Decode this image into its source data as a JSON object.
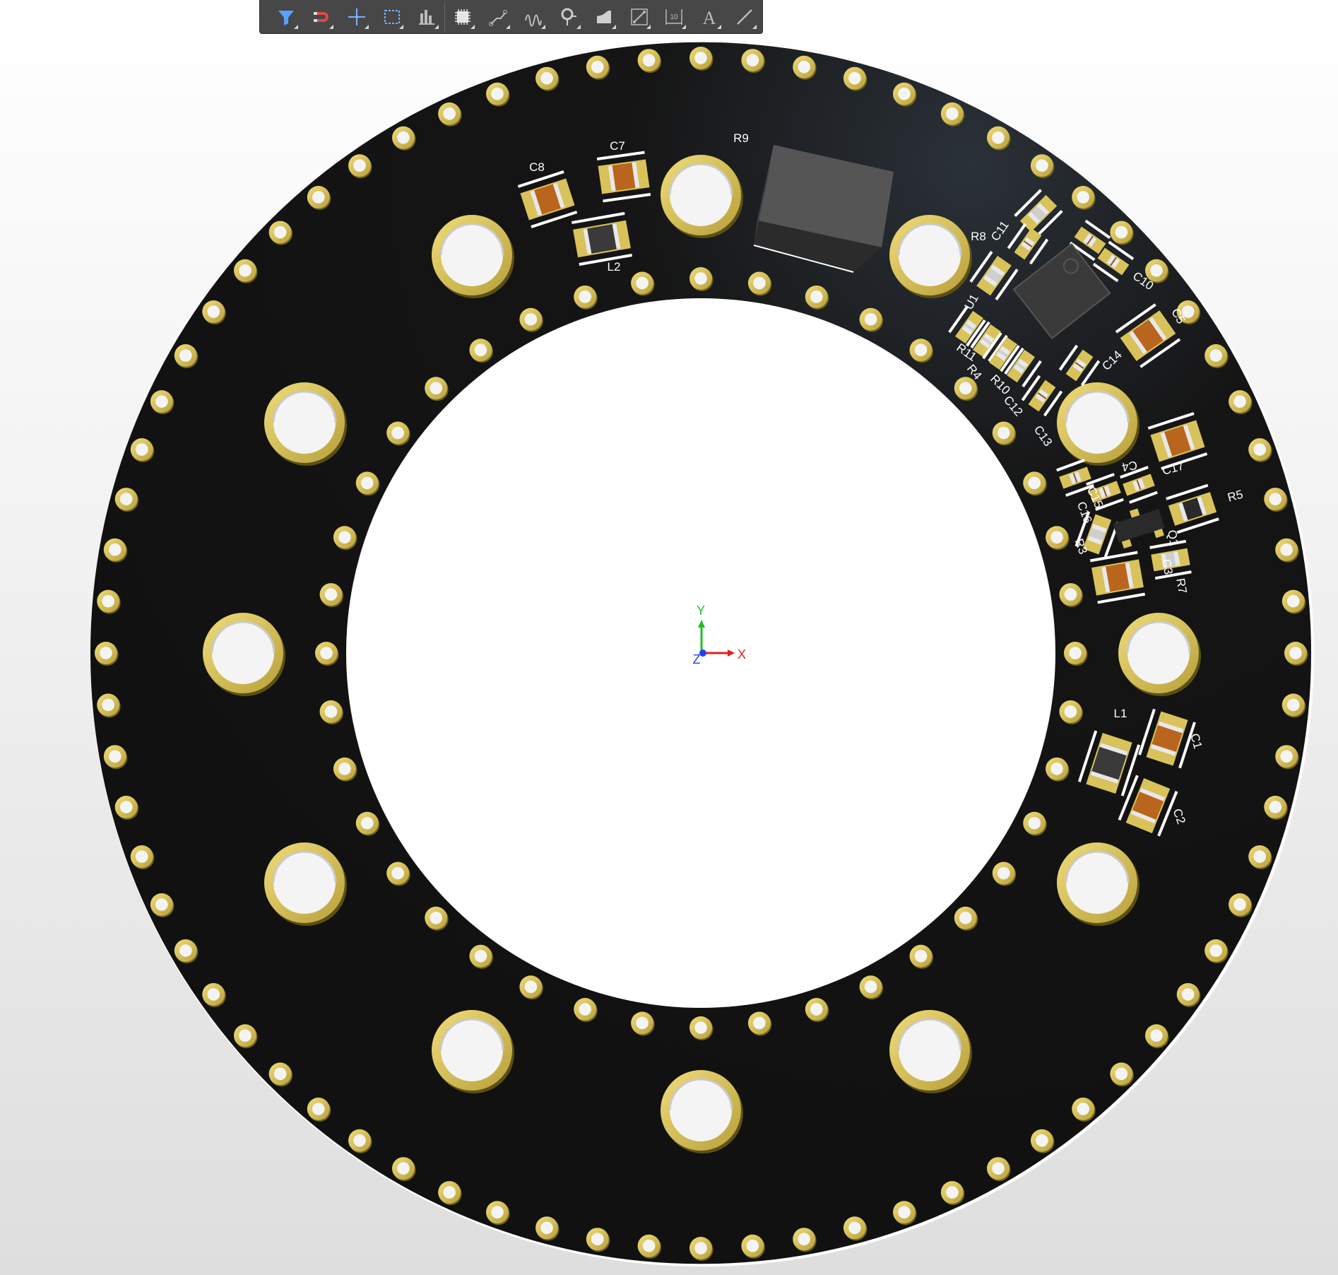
{
  "colors": {
    "board": "#131313",
    "gold_ring": "#d8c25a",
    "gold_dark": "#9f8a2a",
    "hole": "#f4f4f4",
    "silkscreen": "#ffffff",
    "copper_body": "#b9651e",
    "toolbar_bg": "#474747",
    "axis_x": "#e02020",
    "axis_y": "#20c020",
    "axis_z": "#2040ff"
  },
  "toolbar": {
    "buttons": [
      {
        "icon": "filter-icon"
      },
      {
        "icon": "snap-magnet-icon"
      },
      {
        "icon": "crosshair-move-icon"
      },
      {
        "icon": "select-rectangle-icon"
      },
      {
        "icon": "align-bottom-icon"
      },
      {
        "icon": "component-chip-icon"
      },
      {
        "icon": "route-track-icon"
      },
      {
        "icon": "interactive-length-icon"
      },
      {
        "icon": "place-via-icon"
      },
      {
        "icon": "polygon-pour-icon"
      },
      {
        "icon": "diff-pair-icon"
      },
      {
        "icon": "dimension-icon"
      },
      {
        "icon": "text-string-icon"
      },
      {
        "icon": "line-icon"
      }
    ],
    "text_glyph": "A",
    "dimension_glyph": "10"
  },
  "axis": {
    "x": "X",
    "y": "Y",
    "z": "Z"
  },
  "designators": [
    {
      "text": "C8",
      "rot": 0
    },
    {
      "text": "C7",
      "rot": 0
    },
    {
      "text": "R9",
      "rot": 0
    },
    {
      "text": "L2",
      "rot": 0
    },
    {
      "text": "R8",
      "rot": 0
    },
    {
      "text": "C11",
      "rot": -55
    },
    {
      "text": "C10",
      "rot": 35
    },
    {
      "text": "C5",
      "rot": 60
    },
    {
      "text": "U1",
      "rot": -60
    },
    {
      "text": "C14",
      "rot": -45
    },
    {
      "text": "R11",
      "rot": 35
    },
    {
      "text": "R4",
      "rot": 50
    },
    {
      "text": "R10",
      "rot": 45
    },
    {
      "text": "C12",
      "rot": 50
    },
    {
      "text": "C13",
      "rot": 55
    },
    {
      "text": "C17",
      "rot": -15
    },
    {
      "text": "C4",
      "rot": 170
    },
    {
      "text": "C15",
      "rot": 65
    },
    {
      "text": "C16",
      "rot": 70
    },
    {
      "text": "R5",
      "rot": -15
    },
    {
      "text": "R3",
      "rot": 70
    },
    {
      "text": "Q1",
      "rot": 80
    },
    {
      "text": "C3",
      "rot": 80
    },
    {
      "text": "R7",
      "rot": 80
    },
    {
      "text": "L1",
      "rot": 0
    },
    {
      "text": "C1",
      "rot": 75
    },
    {
      "text": "C2",
      "rot": 70
    }
  ]
}
